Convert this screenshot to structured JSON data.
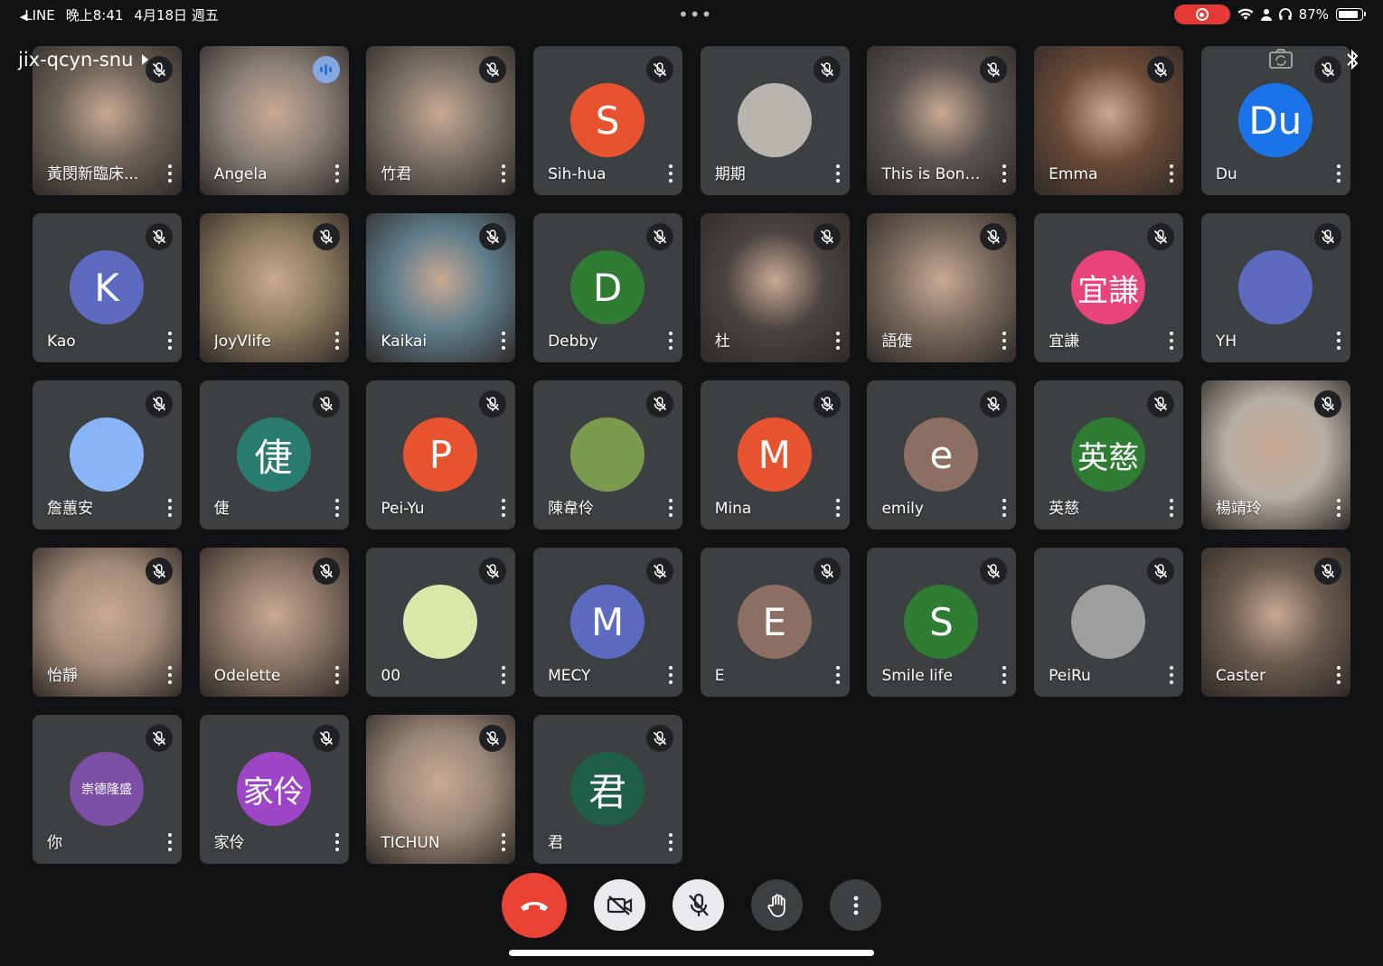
{
  "status_bar": {
    "back_app": "LINE",
    "time": "晚上8:41",
    "date": "4月18日 週五",
    "battery": "87%"
  },
  "meeting": {
    "code": "jix-qcyn-snu"
  },
  "participants": [
    {
      "name": "黃閔新臨床...",
      "kind": "video",
      "bg": "#6d6257",
      "mic": "muted"
    },
    {
      "name": "Angela",
      "kind": "video",
      "bg": "#8a7f78",
      "mic": "speaking"
    },
    {
      "name": "竹君",
      "kind": "video",
      "bg": "#7a7066",
      "mic": "muted"
    },
    {
      "name": "Sih-hua",
      "kind": "avatar",
      "letter": "S",
      "color": "#e8532f",
      "mic": "muted"
    },
    {
      "name": "期期",
      "kind": "photo",
      "color": "#b9b4ae",
      "mic": "muted"
    },
    {
      "name": "This is Bonner",
      "kind": "video",
      "bg": "#5b5450",
      "mic": "muted"
    },
    {
      "name": "Emma",
      "kind": "video",
      "bg": "#6b4a38",
      "mic": "muted"
    },
    {
      "name": "Du",
      "kind": "avatar",
      "letter": "Du",
      "color": "#1a73e8",
      "mic": "muted"
    },
    {
      "name": "Kao",
      "kind": "avatar",
      "letter": "K",
      "color": "#5c6bc0",
      "mic": "muted"
    },
    {
      "name": "JoyVlife",
      "kind": "video",
      "bg": "#8c7a5e",
      "mic": "muted"
    },
    {
      "name": "Kaikai",
      "kind": "video",
      "bg": "#5f7d8c",
      "mic": "muted"
    },
    {
      "name": "Debby",
      "kind": "avatar",
      "letter": "D",
      "color": "#2e7d32",
      "mic": "muted"
    },
    {
      "name": "杜",
      "kind": "video",
      "bg": "#4a4340",
      "mic": "muted"
    },
    {
      "name": "語倢",
      "kind": "video",
      "bg": "#7a6a5e",
      "mic": "muted"
    },
    {
      "name": "宜謙",
      "kind": "avatar",
      "letter": "宜謙",
      "color": "#e8437a",
      "mic": "muted"
    },
    {
      "name": "YH",
      "kind": "photo",
      "color": "#5c6bc0",
      "mic": "muted"
    },
    {
      "name": "詹蕙安",
      "kind": "photo",
      "color": "#8ab4f8",
      "mic": "muted"
    },
    {
      "name": "倢",
      "kind": "avatar",
      "letter": "倢",
      "color": "#2a7d6e",
      "mic": "muted"
    },
    {
      "name": "Pei-Yu",
      "kind": "avatar",
      "letter": "P",
      "color": "#e8532f",
      "mic": "muted"
    },
    {
      "name": "陳韋伶",
      "kind": "photo",
      "color": "#7a9b4e",
      "mic": "muted"
    },
    {
      "name": "Mina",
      "kind": "avatar",
      "letter": "M",
      "color": "#e8532f",
      "mic": "muted"
    },
    {
      "name": "emily",
      "kind": "avatar",
      "letter": "e",
      "color": "#8d6e63",
      "mic": "muted"
    },
    {
      "name": "英慈",
      "kind": "avatar",
      "letter": "英慈",
      "color": "#2e7d32",
      "mic": "muted"
    },
    {
      "name": "楊靖玲",
      "kind": "video",
      "bg": "#b7aea4",
      "mic": "muted"
    },
    {
      "name": "怡靜",
      "kind": "video",
      "bg": "#a38b78",
      "mic": "muted"
    },
    {
      "name": "Odelette",
      "kind": "video",
      "bg": "#8a7464",
      "mic": "muted"
    },
    {
      "name": "00",
      "kind": "photo",
      "color": "#d8e8a8",
      "mic": "muted"
    },
    {
      "name": "MECY",
      "kind": "avatar",
      "letter": "M",
      "color": "#5c6bc0",
      "mic": "muted"
    },
    {
      "name": "E",
      "kind": "avatar",
      "letter": "E",
      "color": "#8d6e63",
      "mic": "muted"
    },
    {
      "name": "Smile life",
      "kind": "avatar",
      "letter": "S",
      "color": "#2e7d32",
      "mic": "muted"
    },
    {
      "name": "PeiRu",
      "kind": "photo",
      "color": "#9e9e9e",
      "mic": "muted"
    },
    {
      "name": "Caster",
      "kind": "video",
      "bg": "#6a5a4e",
      "mic": "muted"
    },
    {
      "name": "你",
      "kind": "avatar",
      "letter": "崇德隆盛",
      "color": "#7b4fa6",
      "mic": "muted",
      "small": true
    },
    {
      "name": "家伶",
      "kind": "avatar",
      "letter": "家伶",
      "color": "#9c45c7",
      "mic": "muted"
    },
    {
      "name": "TICHUN",
      "kind": "video",
      "bg": "#9a8676",
      "mic": "muted"
    },
    {
      "name": "君",
      "kind": "avatar",
      "letter": "君",
      "color": "#1e5e4a",
      "mic": "muted"
    }
  ],
  "controls": {
    "hangup": "hangup-icon",
    "camera": "camera-off-icon",
    "microphone": "mic-off-icon",
    "raise_hand": "hand-icon",
    "more": "more-vert-icon"
  }
}
